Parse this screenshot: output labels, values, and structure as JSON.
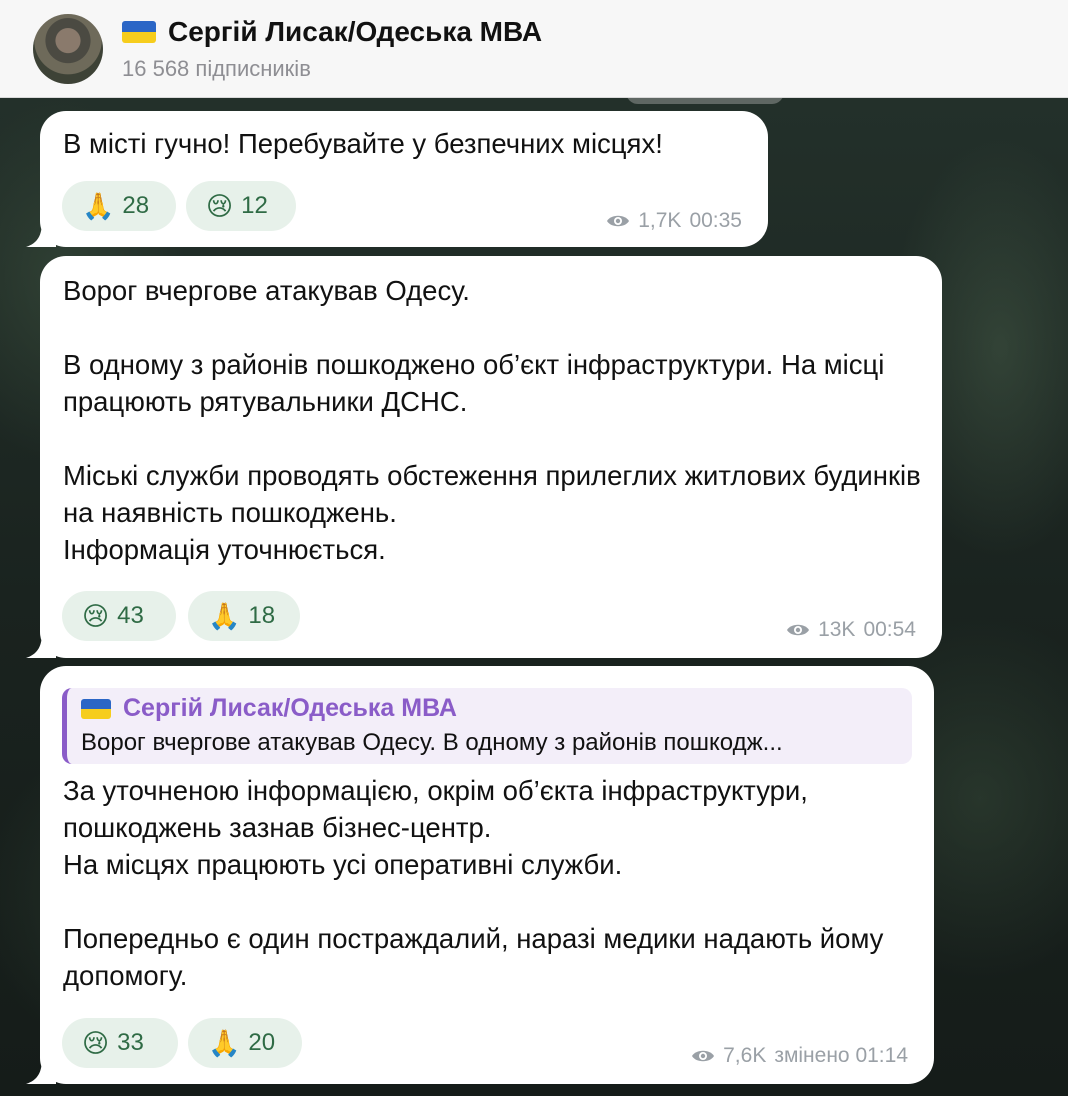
{
  "header": {
    "channel_name": "Сергій Лисак/Одеська МВА",
    "subscribers": "16 568 підписників"
  },
  "messages": [
    {
      "text": "В місті гучно! Перебувайте у безпечних місцях!",
      "reactions": [
        {
          "emoji": "🙏",
          "count": "28"
        },
        {
          "emoji": "😢",
          "count": "12"
        }
      ],
      "views": "1,7K",
      "time": "00:35"
    },
    {
      "text": "Ворог вчергове атакував Одесу.\n\nВ одному з районів пошкоджено об’єкт інфраструктури. На місці працюють рятувальники ДСНС.\n\nМіські служби проводять обстеження прилеглих житлових будинків на наявність пошкоджень.\nІнформація уточнюється.",
      "reactions": [
        {
          "emoji": "😢",
          "count": "43"
        },
        {
          "emoji": "🙏",
          "count": "18"
        }
      ],
      "views": "13K",
      "time": "00:54"
    },
    {
      "reply": {
        "author": "Сергій Лисак/Одеська МВА",
        "preview": "Ворог вчергове атакував Одесу.  В одному з районів пошкодж..."
      },
      "text": "За уточненою інформацією, окрім об’єкта інфраструктури, пошкоджень зазнав бізнес-центр.\nНа місцях працюють усі оперативні служби.\n\nПопередньо є один постраждалий, наразі медики надають йому допомогу.",
      "reactions": [
        {
          "emoji": "😢",
          "count": "33"
        },
        {
          "emoji": "🙏",
          "count": "20"
        }
      ],
      "views": "7,6K",
      "time": "змінено 01:14"
    }
  ],
  "colors": {
    "reaction_bg": "#e7f1ea",
    "reaction_text": "#2f6b45",
    "reply_accent": "#8a5cc8",
    "flag_blue": "#2b66c6",
    "flag_yellow": "#f6cd1d"
  }
}
